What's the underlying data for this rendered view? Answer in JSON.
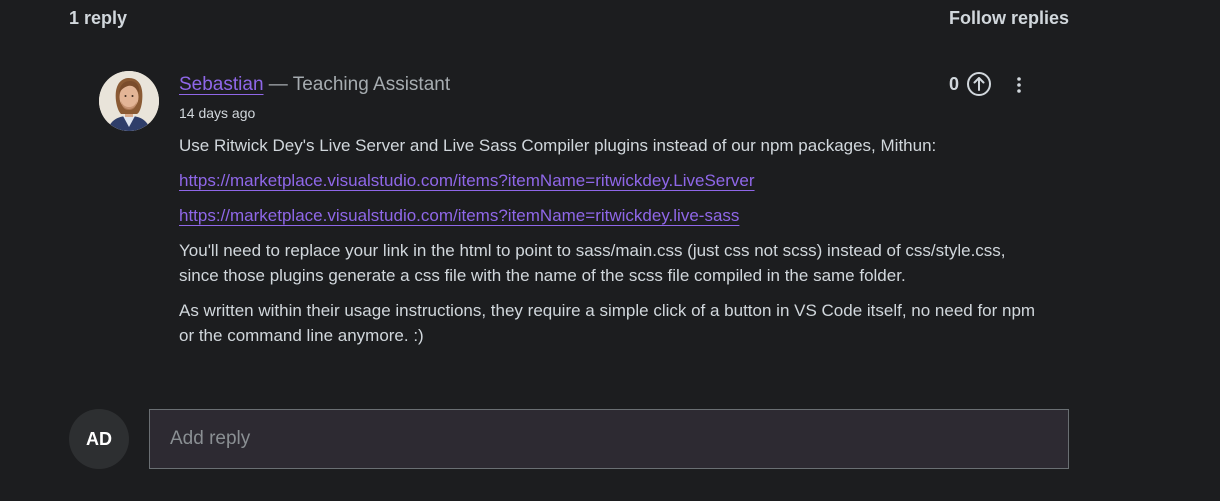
{
  "thread": {
    "reply_count": "1 reply",
    "follow_label": "Follow replies"
  },
  "reply": {
    "author": "Sebastian",
    "separator": " — ",
    "role": "Teaching Assistant",
    "timestamp": "14 days ago",
    "votes": "0",
    "paragraphs": {
      "intro": "Use Ritwick Dey's Live Server and Live Sass Compiler plugins instead of our npm packages, Mithun:",
      "link1": "https://marketplace.visualstudio.com/items?itemName=ritwickdey.LiveServer",
      "link2": "https://marketplace.visualstudio.com/items?itemName=ritwickdey.live-sass",
      "p2": "You'll need to replace your link in the html to point to sass/main.css (just css not scss) instead of css/style.css, since those plugins generate a css file with the name of the scss file compiled in the same folder.",
      "p3": "As written within their usage instructions, they require a simple click of a button in VS Code itself, no need for npm or the command line anymore. :)"
    }
  },
  "composer": {
    "user_initials": "AD",
    "placeholder": "Add reply"
  },
  "colors": {
    "background": "#1c1d1f",
    "link": "#8f67e8",
    "text": "#d1d7dc"
  },
  "icons": {
    "upvote": "arrow-up-circle-icon",
    "more": "vertical-dots-icon"
  }
}
